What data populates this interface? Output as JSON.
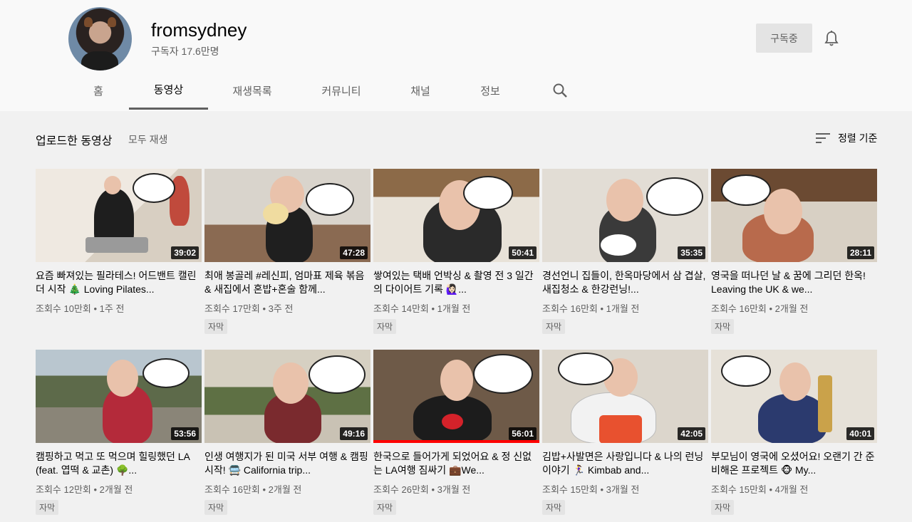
{
  "channel": {
    "name": "fromsydney",
    "subscribers": "구독자 17.6만명",
    "subscribe_label": "구독중"
  },
  "tabs": [
    {
      "label": "홈"
    },
    {
      "label": "동영상",
      "active": true
    },
    {
      "label": "재생목록"
    },
    {
      "label": "커뮤니티"
    },
    {
      "label": "채널"
    },
    {
      "label": "정보"
    }
  ],
  "section": {
    "title": "업로드한 동영상",
    "play_all": "모두 재생",
    "sort_label": "정렬 기준"
  },
  "videos": [
    {
      "title": "요즘 빠져있는 필라테스! 어드밴트 캘린더 시작 🎄 Loving Pilates...",
      "duration": "39:02",
      "views": "조회수 10만회",
      "age": "1주 전",
      "badge": ""
    },
    {
      "title": "최애 봉골레 #레신피, 엄마표 제육 볶음 & 새집에서 혼밥+혼술 함께...",
      "duration": "47:28",
      "views": "조회수 17만회",
      "age": "3주 전",
      "badge": "자막"
    },
    {
      "title": "쌓여있는 택배 언박싱 & 촬영 전 3 일간의 다이어트 기록 🙋🏻‍♀️...",
      "duration": "50:41",
      "views": "조회수 14만회",
      "age": "1개월 전",
      "badge": "자막"
    },
    {
      "title": "경선언니 집들이, 한옥마당에서 삼 겹살, 새집청소 & 한강런닝!...",
      "duration": "35:35",
      "views": "조회수 16만회",
      "age": "1개월 전",
      "badge": "자막"
    },
    {
      "title": "영국을 떠나던 날 & 꿈에 그리던 한옥! Leaving the UK & we...",
      "duration": "28:11",
      "views": "조회수 16만회",
      "age": "2개월 전",
      "badge": "자막"
    },
    {
      "title": "캠핑하고 먹고 또 먹으며 힐링했던 LA (feat. 엽떡 & 교촌) 🌳...",
      "duration": "53:56",
      "views": "조회수 12만회",
      "age": "2개월 전",
      "badge": "자막"
    },
    {
      "title": "인생 여행지가 된 미국 서부 여행 & 캠핑 시작! 🚍 California trip...",
      "duration": "49:16",
      "views": "조회수 16만회",
      "age": "2개월 전",
      "badge": "자막"
    },
    {
      "title": "한국으로 들어가게 되었어요 & 정 신없는 LA여행 짐싸기 💼We...",
      "duration": "56:01",
      "views": "조회수 26만회",
      "age": "3개월 전",
      "badge": "자막",
      "progress": 1.0
    },
    {
      "title": "김밥+사발면은 사랑입니다 & 나의 런닝 이야기 🏃‍♀️ Kimbab and...",
      "duration": "42:05",
      "views": "조회수 15만회",
      "age": "3개월 전",
      "badge": "자막"
    },
    {
      "title": "부모님이 영국에 오셨어요! 오랜기 간 준비해온 프로젝트 🐵 My...",
      "duration": "40:01",
      "views": "조회수 15만회",
      "age": "4개월 전",
      "badge": "자막"
    }
  ],
  "icons": {
    "bell": "bell-icon",
    "search": "search-icon",
    "sort": "sort-icon"
  },
  "colors": {
    "progress": "#ff0000",
    "header_bg": "#f9f9f9",
    "page_bg": "#f1f1f1"
  }
}
